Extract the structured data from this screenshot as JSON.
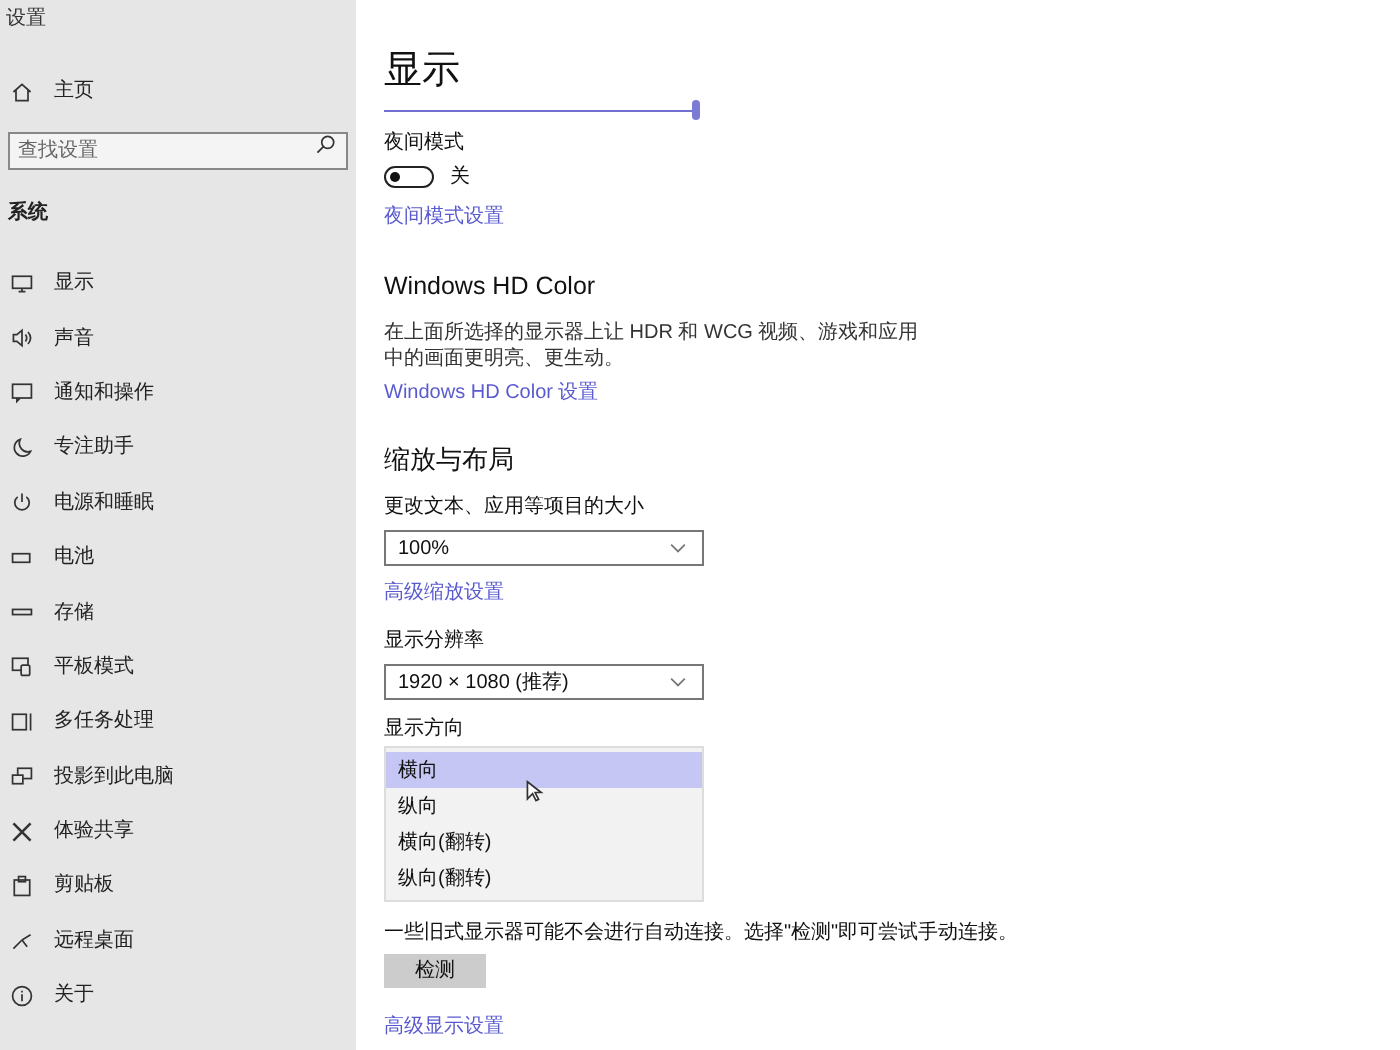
{
  "window": {
    "title": "设置"
  },
  "sidebar": {
    "home": "主页",
    "search": {
      "placeholder": "查找设置"
    },
    "section": "系统",
    "items": [
      {
        "label": "显示"
      },
      {
        "label": "声音"
      },
      {
        "label": "通知和操作"
      },
      {
        "label": "专注助手"
      },
      {
        "label": "电源和睡眠"
      },
      {
        "label": "电池"
      },
      {
        "label": "存储"
      },
      {
        "label": "平板模式"
      },
      {
        "label": "多任务处理"
      },
      {
        "label": "投影到此电脑"
      },
      {
        "label": "体验共享"
      },
      {
        "label": "剪贴板"
      },
      {
        "label": "远程桌面"
      },
      {
        "label": "关于"
      }
    ]
  },
  "page": {
    "title": "显示",
    "brightness": {
      "level": 1.0
    },
    "night_light": {
      "label": "夜间模式",
      "on": false,
      "state_text": "关",
      "link": "夜间模式设置"
    },
    "hd_color": {
      "heading": "Windows HD Color",
      "description": "在上面所选择的显示器上让 HDR 和 WCG 视频、游戏和应用中的画面更明亮、更生动。",
      "link": "Windows HD Color 设置"
    },
    "scale": {
      "heading": "缩放与布局",
      "size_label": "更改文本、应用等项目的大小",
      "size_value": "100%",
      "advanced_link": "高级缩放设置",
      "resolution_label": "显示分辨率",
      "resolution_value": "1920 × 1080 (推荐)",
      "orientation_label": "显示方向",
      "orientation_options": [
        {
          "label": "横向",
          "selected": true
        },
        {
          "label": "纵向",
          "selected": false
        },
        {
          "label": "横向(翻转)",
          "selected": false
        },
        {
          "label": "纵向(翻转)",
          "selected": false
        }
      ]
    },
    "detect_note": "一些旧式显示器可能不会进行自动连接。选择\"检测\"即可尝试手动连接。",
    "detect_button": "检测",
    "advanced_display_link": "高级显示设置"
  }
}
